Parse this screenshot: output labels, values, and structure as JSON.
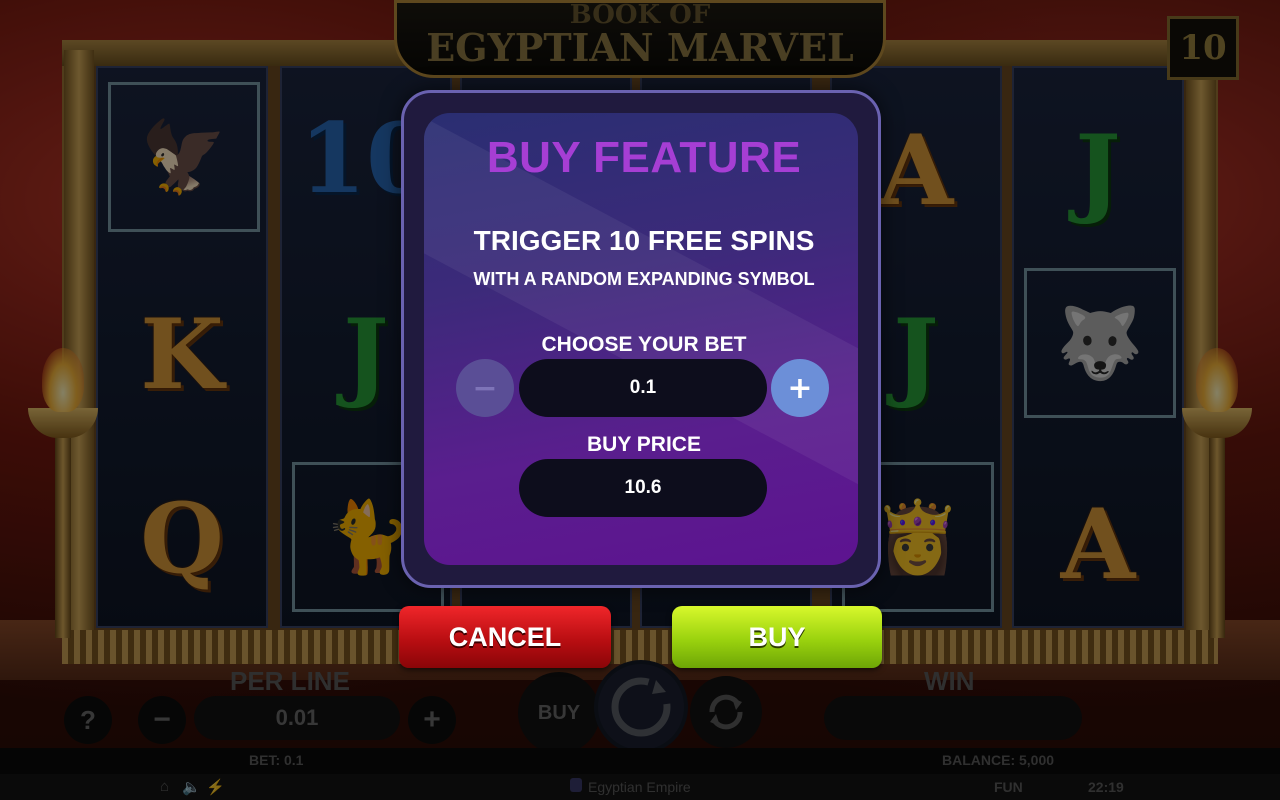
{
  "game": {
    "title_line1": "BOOK OF",
    "title_line2": "EGYPTIAN MARVEL",
    "lines_count": "10",
    "reels": [
      {
        "symbols": [
          "eagle",
          "K",
          "Q"
        ]
      },
      {
        "symbols": [
          "10",
          "J",
          "cat"
        ]
      },
      {
        "symbols": [
          "",
          "",
          ""
        ]
      },
      {
        "symbols": [
          "A",
          "J",
          "cleopatra"
        ]
      },
      {
        "symbols": [
          "J",
          "anubis",
          "A"
        ]
      }
    ],
    "symbol_icons": {
      "eagle": "🦅",
      "cat": "🐈",
      "cleopatra": "👸",
      "anubis": "🐺"
    }
  },
  "modal": {
    "title": "BUY FEATURE",
    "subtitle": "TRIGGER 10 FREE SPINS",
    "description": "WITH A RANDOM EXPANDING SYMBOL",
    "bet_label": "CHOOSE YOUR BET",
    "bet_value": "0.1",
    "minus_symbol": "−",
    "plus_symbol": "+",
    "price_label": "BUY PRICE",
    "price_value": "10.6",
    "cancel_label": "CANCEL",
    "buy_label": "BUY"
  },
  "hud": {
    "help_symbol": "?",
    "per_line_label": "PER LINE",
    "per_line_value": "0.01",
    "minus_symbol": "−",
    "plus_symbol": "+",
    "buy_label": "BUY",
    "win_label": "WIN",
    "win_value": "",
    "bet_text": "BET: 0.1",
    "balance_text": "BALANCE: 5,000"
  },
  "footer": {
    "provider": "Egyptian Empire",
    "mode": "FUN",
    "time": "22:19"
  },
  "colors": {
    "modal_title": "#a63ed4",
    "cancel": "#d0161a",
    "buy": "#a8dc12"
  }
}
